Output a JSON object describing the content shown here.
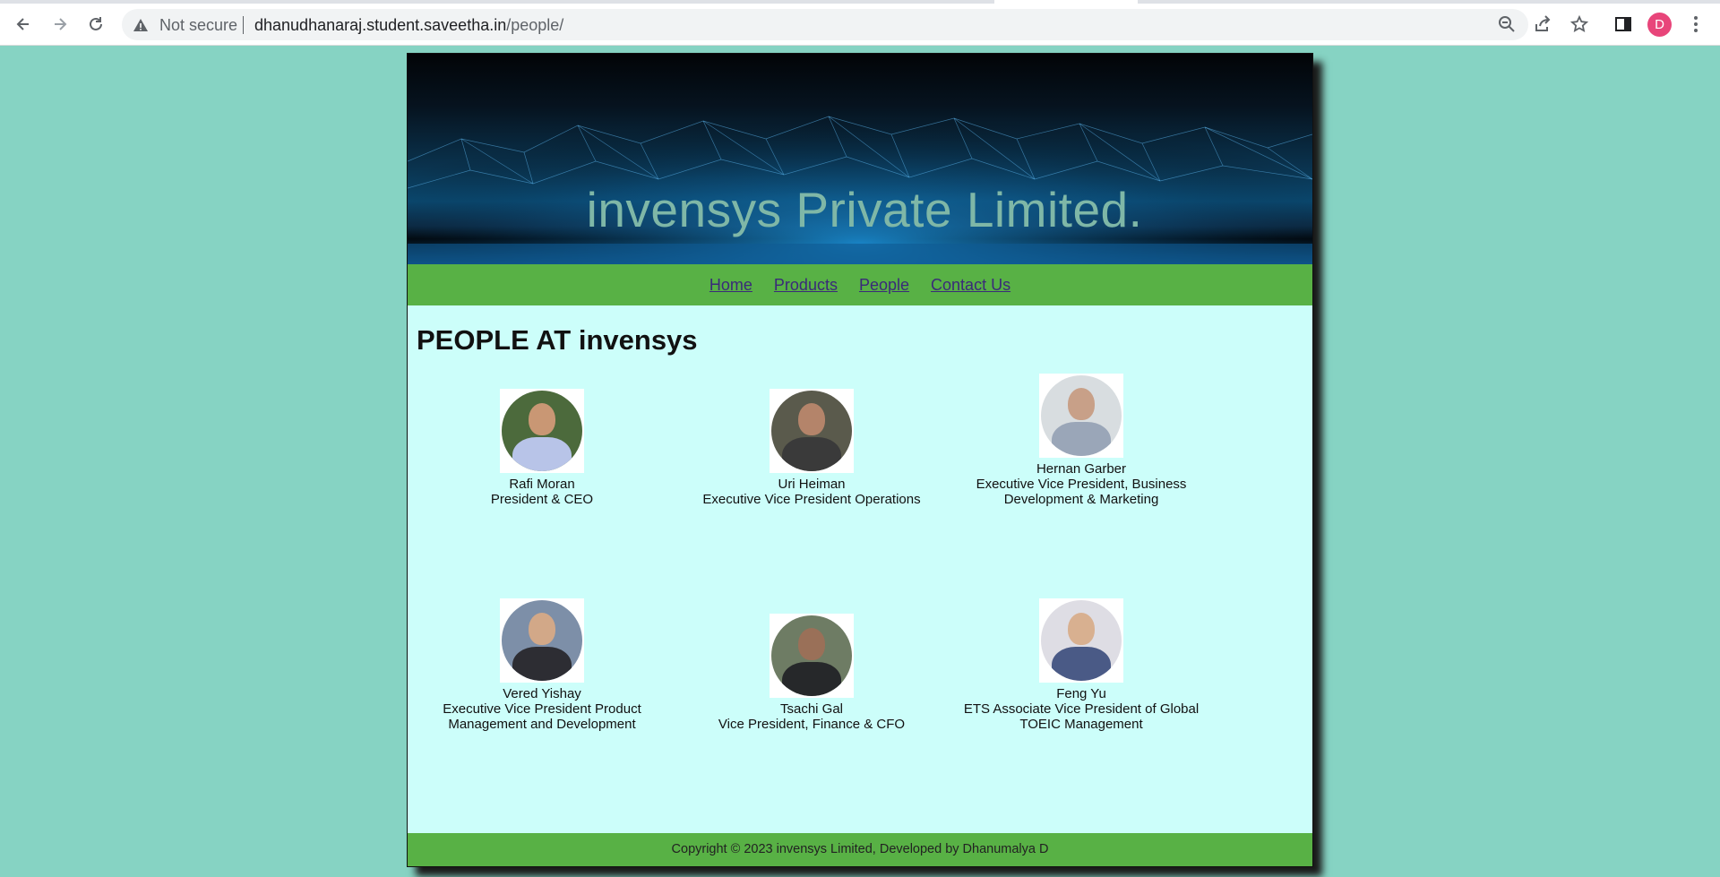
{
  "browser": {
    "security_label": "Not secure",
    "url_host": "dhanudhanaraj.student.saveetha.in",
    "url_path": "/people/",
    "avatar_letter": "D"
  },
  "site": {
    "banner_title": "invensys Private Limited.",
    "nav": [
      "Home",
      "Products",
      "People",
      "Contact Us"
    ],
    "heading": "PEOPLE AT invensys",
    "people": [
      {
        "name": "Rafi Moran",
        "title": "President & CEO"
      },
      {
        "name": "Uri Heiman",
        "title": "Executive Vice President Operations"
      },
      {
        "name": "Hernan Garber",
        "title": "Executive Vice President, Business Development & Marketing"
      },
      {
        "name": "Vered Yishay",
        "title": "Executive Vice President Product Management and Development"
      },
      {
        "name": "Tsachi Gal",
        "title": "Vice President, Finance & CFO"
      },
      {
        "name": "Feng Yu",
        "title": "ETS Associate Vice President of Global TOEIC Management"
      }
    ],
    "footer": "Copyright © 2023 invensys Limited, Developed by Dhanumalya D"
  },
  "colors": {
    "page_bg": "#86d3c3",
    "content_bg": "#ccfefa",
    "nav_bg": "#58b145",
    "link": "#3a2a79",
    "banner_text": "#7fb7a7"
  }
}
